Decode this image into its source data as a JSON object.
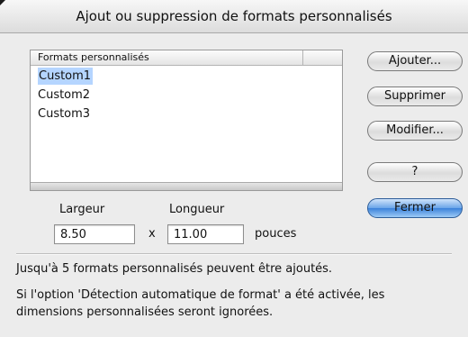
{
  "window": {
    "title": "Ajout ou suppression de formats personnalisés"
  },
  "formats_list": {
    "column_header": "Formats personnalisés",
    "items": [
      "Custom1",
      "Custom2",
      "Custom3"
    ],
    "selected_index": 0
  },
  "buttons": {
    "add": "Ajouter...",
    "delete": "Supprimer",
    "modify": "Modifier...",
    "help": "?",
    "close": "Fermer"
  },
  "size": {
    "width_label": "Largeur",
    "width_value": "8.50",
    "separator": "x",
    "length_label": "Longueur",
    "length_value": "11.00",
    "units": "pouces"
  },
  "info": {
    "line1": "Jusqu'à 5 formats personnalisés peuvent être ajoutés.",
    "line2": "Si l'option 'Détection automatique de format' a été activée, les",
    "line3": "dimensions personnalisées seront ignorées."
  },
  "colors": {
    "selection": "#b5d5ff",
    "default_button": "#3b82da"
  }
}
